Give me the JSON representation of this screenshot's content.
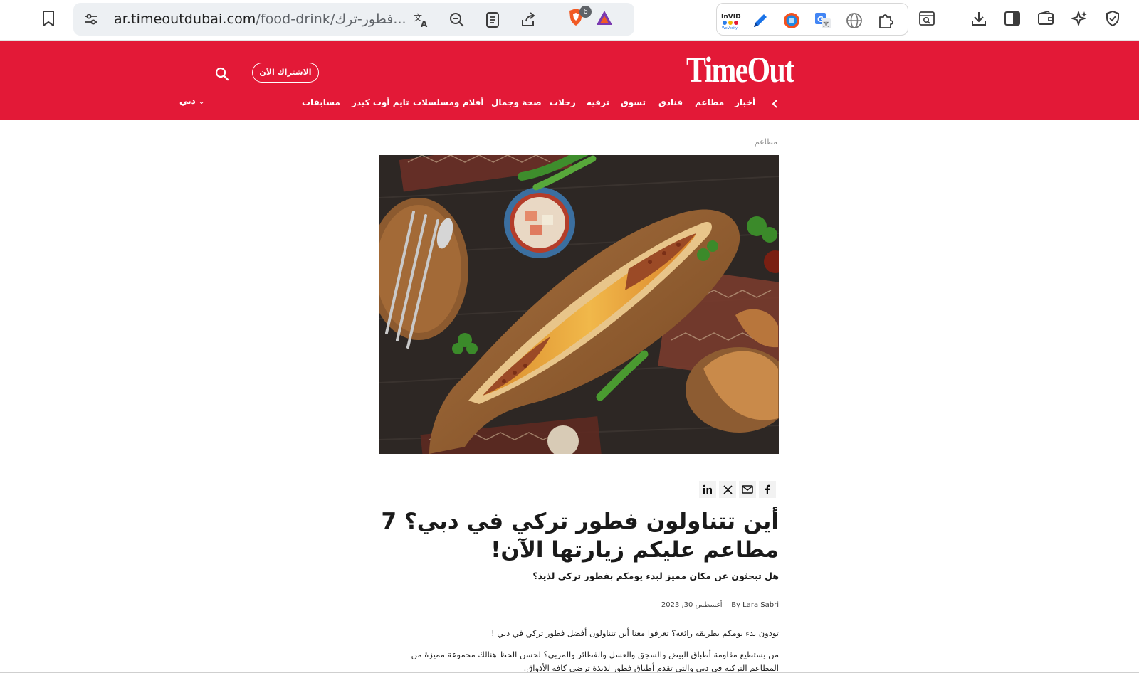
{
  "browser": {
    "url_host": "ar.timeoutdubai.com",
    "url_path": "/food-drink/فطور-ترك...",
    "tab_count_badge": "6",
    "extensions": [
      "invid-icon",
      "pen-icon",
      "chrome-ext-icon",
      "google-translate-icon",
      "globe-icon",
      "puzzle-icon",
      "tab-search-icon"
    ],
    "invid_label_top": "InVID",
    "invid_label_bottom": "WeVerify"
  },
  "site": {
    "logo": "TimeOut",
    "subscribe_label": "الاشتراك الآن",
    "city": "دبي",
    "nav": [
      "أخبار",
      "مطاعم",
      "فنادق",
      "تسوق",
      "ترفيه",
      "رحلات",
      "صحة وجمال",
      "أفلام ومسلسلات",
      "تايم أوت كيدز",
      "مسابقات"
    ],
    "brand_color": "#e31937"
  },
  "article": {
    "breadcrumb": "مطاعم",
    "title": "أين تتناولون فطور تركي في دبي؟ 7 مطاعم عليكم زيارتها الآن!",
    "subtitle": "هل تبحثون عن مكان مميز لبدء يومكم بفطور تركي لذيذ؟",
    "by_label": "By",
    "author": "Lara Sabri",
    "date": "أغسطس 30, 2023",
    "paragraph1": "تودون بدء يومكم بطريقة رائعة؟ تعرفوا معنا أين تتناولون أفضل فطور تركي في دبي !",
    "paragraph2_line1": "من يستطيع مقاومة أطباق البيض والسجق والعسل والفطائر والمربى؟ لحسن الحظ هنالك مجموعة مميزة من",
    "paragraph2_line2": "المطاعم التركية في دبي والتي تقدم أطباق فطور لذيذة ترضي كافة الأذواق."
  }
}
